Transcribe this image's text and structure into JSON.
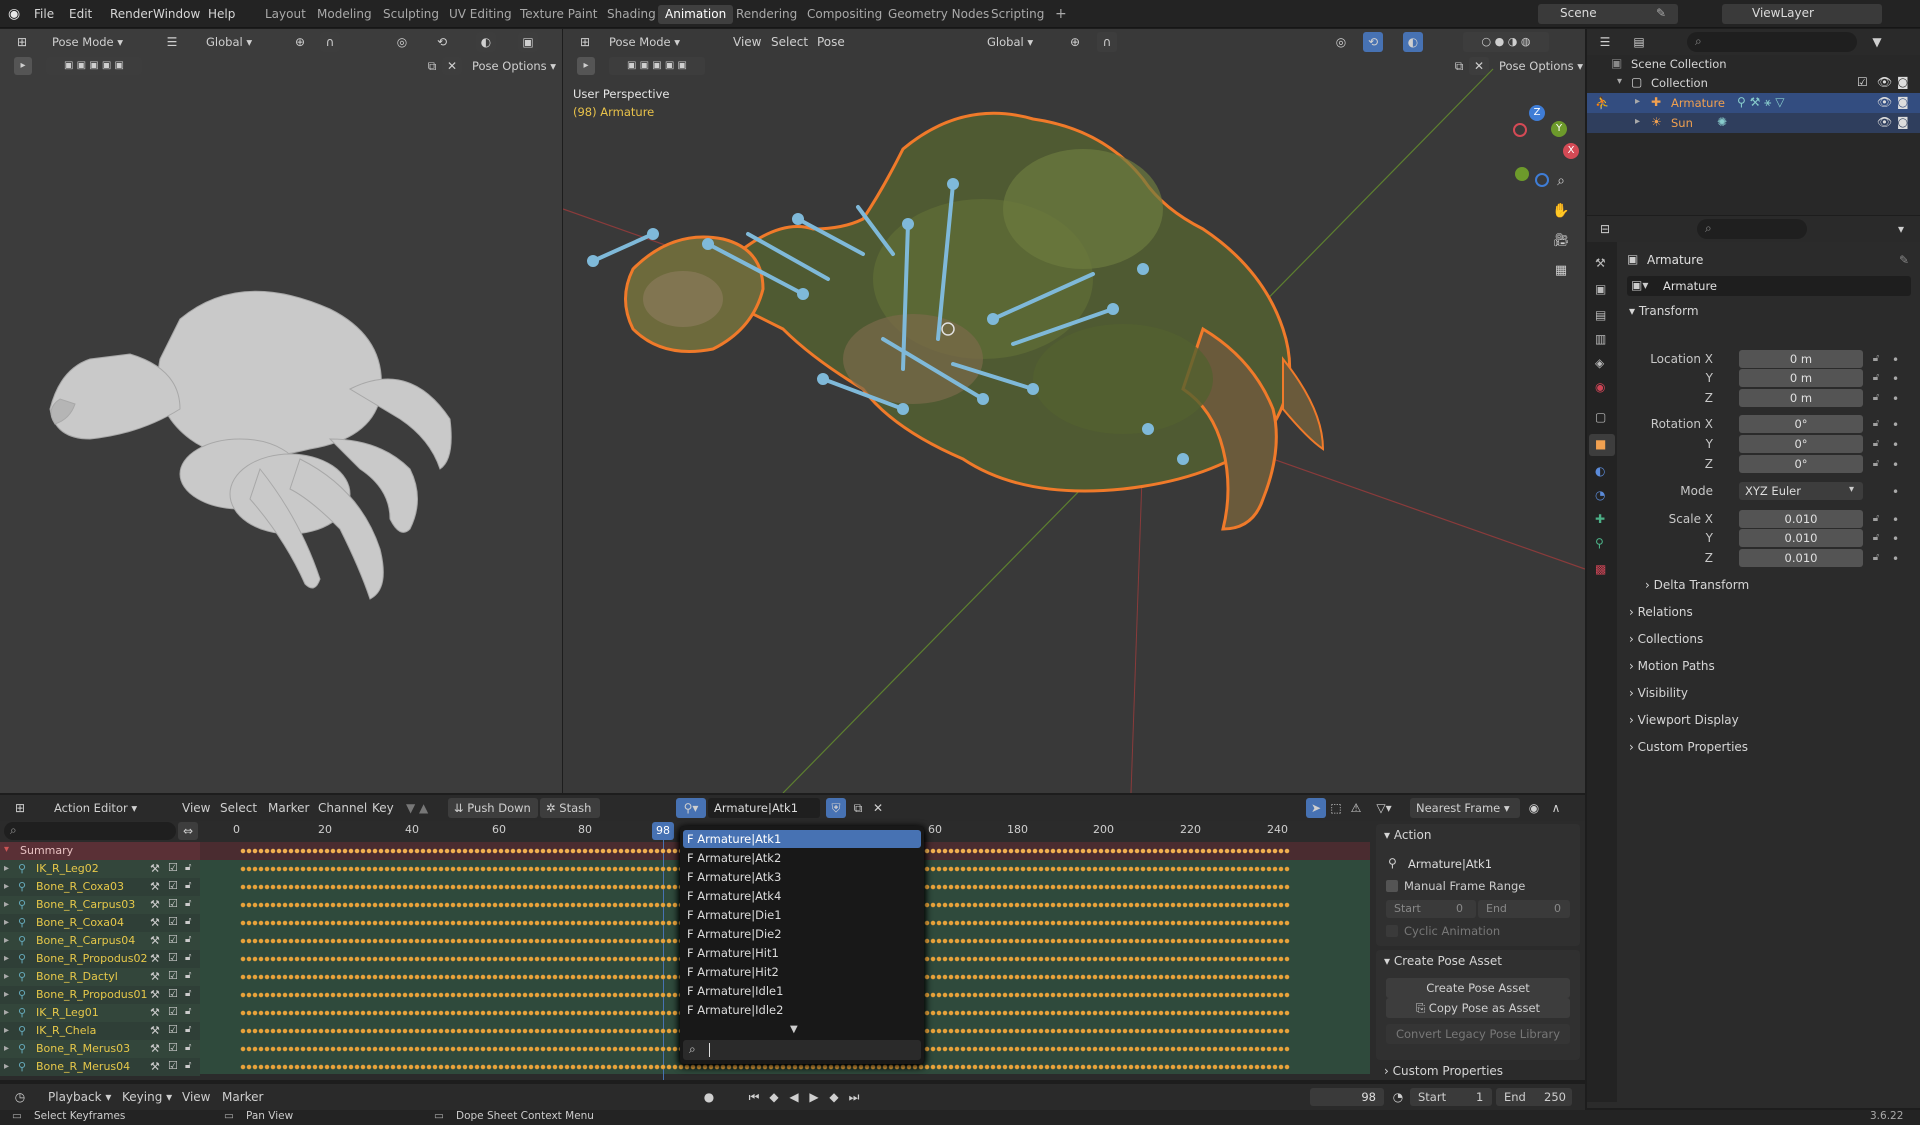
{
  "menus": [
    "File",
    "Edit",
    "Render",
    "Window",
    "Help"
  ],
  "workspaces": [
    "Layout",
    "Modeling",
    "Sculpting",
    "UV Editing",
    "Texture Paint",
    "Shading",
    "Animation",
    "Rendering",
    "Compositing",
    "Geometry Nodes",
    "Scripting"
  ],
  "active_workspace": "Animation",
  "scene_name": "Scene",
  "view_layer": "ViewLayer",
  "left_view": {
    "mode": "Pose Mode",
    "orientation": "Global",
    "pose_options": "Pose Options"
  },
  "main_view": {
    "mode": "Pose Mode",
    "menus": [
      "View",
      "Select",
      "Pose"
    ],
    "orientation": "Global",
    "pose_options": "Pose Options",
    "overlay_title": "User Perspective",
    "overlay_sub": "(98) Armature"
  },
  "outliner": {
    "root": "Scene Collection",
    "collection": "Collection",
    "items": [
      {
        "label": "Armature",
        "selected": true
      },
      {
        "label": "Sun",
        "selected": false
      }
    ]
  },
  "properties": {
    "object_name": "Armature",
    "data_name": "Armature",
    "transform_label": "Transform",
    "location": {
      "label_x": "Location X",
      "label_y": "Y",
      "label_z": "Z",
      "x": "0 m",
      "y": "0 m",
      "z": "0 m"
    },
    "rotation": {
      "label_x": "Rotation X",
      "label_y": "Y",
      "label_z": "Z",
      "x": "0°",
      "y": "0°",
      "z": "0°"
    },
    "mode_label": "Mode",
    "mode_value": "XYZ Euler",
    "scale": {
      "label_x": "Scale X",
      "label_y": "Y",
      "label_z": "Z",
      "x": "0.010",
      "y": "0.010",
      "z": "0.010"
    },
    "collapsed": [
      "Delta Transform",
      "Relations",
      "Collections",
      "Motion Paths",
      "Visibility",
      "Viewport Display",
      "Custom Properties"
    ]
  },
  "dopesheet": {
    "editor_mode": "Action Editor",
    "menus": [
      "View",
      "Select",
      "Marker",
      "Channel",
      "Key"
    ],
    "push_down": "Push Down",
    "stash": "Stash",
    "action_name": "Armature|Atk1",
    "snap": "Nearest Frame",
    "current_frame_label": "98",
    "frame_ticks": [
      "0",
      "20",
      "40",
      "60",
      "80",
      "60",
      "180",
      "200",
      "220",
      "240"
    ],
    "summary": "Summary",
    "channels": [
      "IK_R_Leg02",
      "Bone_R_Coxa03",
      "Bone_R_Carpus03",
      "Bone_R_Coxa04",
      "Bone_R_Carpus04",
      "Bone_R_Propodus02",
      "Bone_R_Dactyl",
      "Bone_R_Propodus01",
      "IK_R_Leg01",
      "IK_R_Chela",
      "Bone_R_Merus03",
      "Bone_R_Merus04"
    ],
    "action_list": [
      "F Armature|Atk1",
      "F Armature|Atk2",
      "F Armature|Atk3",
      "F Armature|Atk4",
      "F Armature|Die1",
      "F Armature|Die2",
      "F Armature|Hit1",
      "F Armature|Hit2",
      "F Armature|Idle1",
      "F Armature|Idle2"
    ],
    "side_panel": {
      "action_header": "Action",
      "action_name": "Armature|Atk1",
      "manual_frame_range": "Manual Frame Range",
      "start_label": "Start",
      "start_value": "0",
      "end_label": "End",
      "end_value": "0",
      "cyclic": "Cyclic Animation",
      "create_pose_header": "Create Pose Asset",
      "create_pose_btn": "Create Pose Asset",
      "copy_pose_btn": "Copy Pose as Asset",
      "convert_btn": "Convert Legacy Pose Library",
      "custom_props": "Custom Properties"
    }
  },
  "timeline": {
    "menus": [
      "Playback",
      "Keying",
      "View",
      "Marker"
    ],
    "current_frame": "98",
    "start_label": "Start",
    "start_value": "1",
    "end_label": "End",
    "end_value": "250"
  },
  "statusbar": {
    "items": [
      "Select Keyframes",
      "Pan View",
      "Dope Sheet Context Menu"
    ],
    "version": "3.6.22"
  }
}
